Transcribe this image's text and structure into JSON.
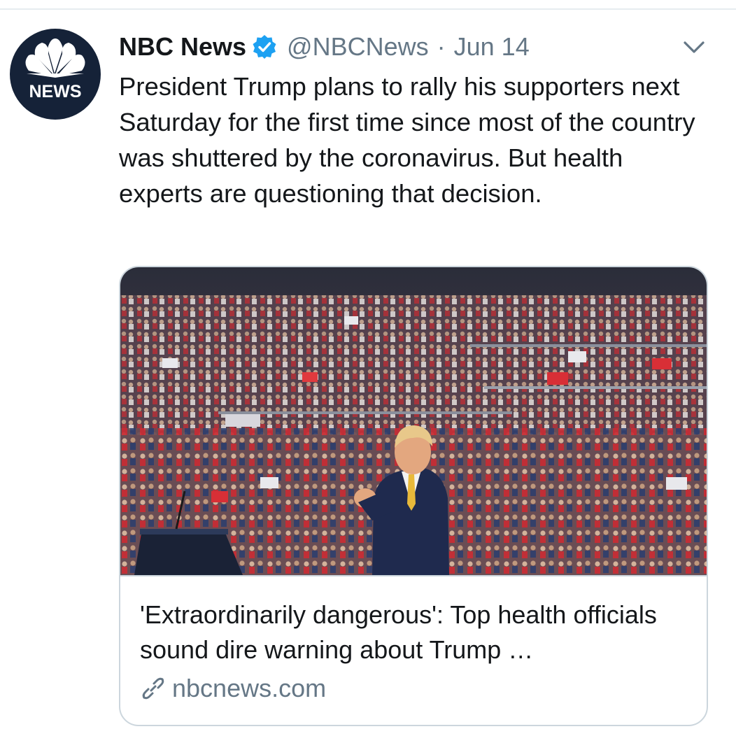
{
  "tweet": {
    "author": {
      "display_name": "NBC News",
      "handle": "@NBCNews",
      "verified": true,
      "avatar_text": "NEWS"
    },
    "separator": "·",
    "date": "Jun 14",
    "text": "President Trump plans to rally his supporters next Saturday for the first time since most of the country was shuttered by the coronavirus. But health experts are questioning that decision.",
    "card": {
      "title": "'Extraordinarily dangerous': Top health officials sound dire warning about Trump …",
      "domain": "nbcnews.com"
    }
  },
  "icons": {
    "verified": "verified-badge-icon",
    "menu": "chevron-down-icon",
    "link": "link-icon"
  },
  "colors": {
    "brand_blue": "#1da1f2",
    "avatar_bg": "#152238",
    "text_primary": "#14171a",
    "text_secondary": "#657786",
    "border": "#ccd6dd"
  }
}
